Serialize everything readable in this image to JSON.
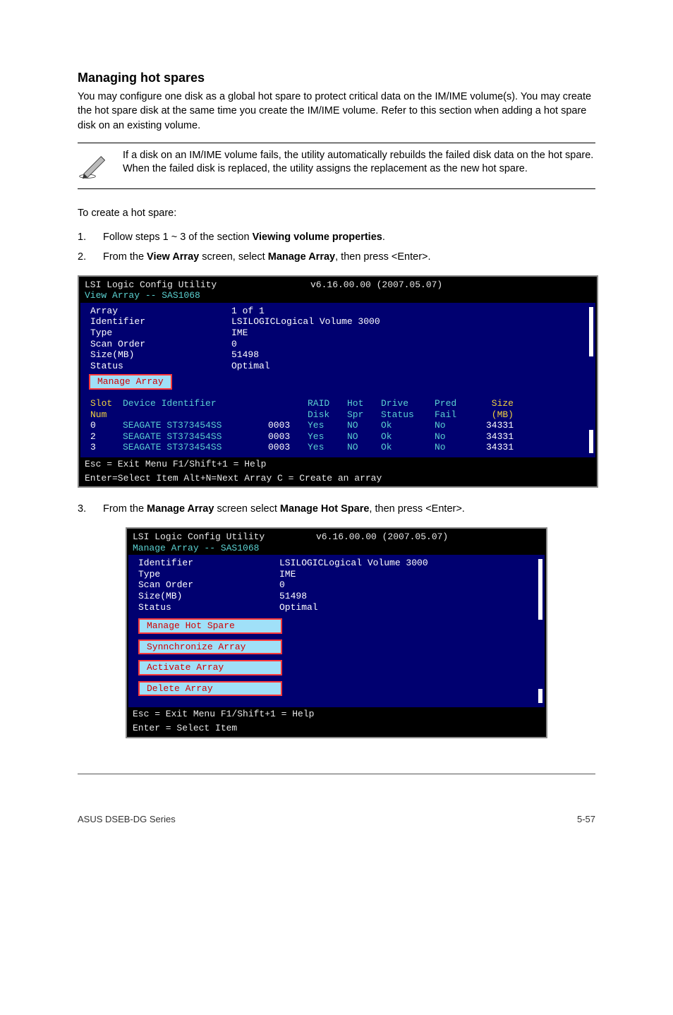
{
  "heading": "Managing hot spares",
  "intro": "You may configure one disk as a global hot spare to protect critical data on the IM/IME volume(s). You may create the hot spare disk at the same time you create the IM/IME volume. Refer to this section when adding a hot spare disk on an existing volume.",
  "note": "If a disk on an IM/IME volume fails, the utility automatically rebuilds the failed disk data on the hot spare. When the failed disk is replaced, the utility assigns the replacement as the new hot spare.",
  "lead": "To create a hot spare:",
  "steps": {
    "s1_num": "1.",
    "s1_a": "Follow steps 1 ~ 3 of the section ",
    "s1_b": "Viewing volume properties",
    "s1_c": ".",
    "s2_num": "2.",
    "s2_a": "From the ",
    "s2_b": "View Array",
    "s2_c": " screen, select ",
    "s2_d": "Manage Array",
    "s2_e": ", then press <Enter>.",
    "s3_num": "3.",
    "s3_a": "From the ",
    "s3_b": "Manage Array",
    "s3_c": " screen select ",
    "s3_d": "Manage Hot Spare",
    "s3_e": ", then press <Enter>."
  },
  "term1": {
    "title_left": "LSI Logic Config Utility",
    "title_right": "v6.16.00.00 (2007.05.07)",
    "sub": "View Array -- SAS1068",
    "fields": {
      "array_l": "Array",
      "array_v": "1 of 1",
      "id_l": "Identifier",
      "id_v": "LSILOGICLogical Volume  3000",
      "type_l": "Type",
      "type_v": "IME",
      "so_l": "Scan Order",
      "so_v": "0",
      "size_l": "Size(MB)",
      "size_v": "51498",
      "stat_l": "Status",
      "stat_v": "Optimal"
    },
    "manage": "Manage Array",
    "thead1": {
      "slot": "Slot",
      "dev": "Device Identifier",
      "num": "",
      "raid": "RAID",
      "hot": "Hot",
      "drive": "Drive",
      "pred": "Pred",
      "size": "Size"
    },
    "thead2": {
      "slot": "Num",
      "dev": "",
      "num": "",
      "raid": "Disk",
      "hot": "Spr",
      "drive": "Status",
      "pred": "Fail",
      "size": "(MB)"
    },
    "rows": [
      {
        "slot": "0",
        "dev": "SEAGATE ST373454SS",
        "num": "0003",
        "raid": "Yes",
        "hot": "NO",
        "drive": "Ok",
        "pred": "No",
        "size": "34331"
      },
      {
        "slot": "2",
        "dev": "SEAGATE ST373454SS",
        "num": "0003",
        "raid": "Yes",
        "hot": "NO",
        "drive": "Ok",
        "pred": "No",
        "size": "34331"
      },
      {
        "slot": "3",
        "dev": "SEAGATE ST373454SS",
        "num": "0003",
        "raid": "Yes",
        "hot": "NO",
        "drive": "Ok",
        "pred": "No",
        "size": "34331"
      }
    ],
    "foot1": "Esc = Exit Menu       F1/Shift+1 = Help",
    "foot2": "Enter=Select Item   Alt+N=Next Array   C = Create an array"
  },
  "term2": {
    "title_left": "LSI Logic Config Utility",
    "title_right": "v6.16.00.00 (2007.05.07)",
    "sub": "Manage Array -- SAS1068",
    "fields": {
      "id_l": "Identifier",
      "id_v": "LSILOGICLogical Volume  3000",
      "type_l": "Type",
      "type_v": "IME",
      "so_l": "Scan Order",
      "so_v": "0",
      "size_l": "Size(MB)",
      "size_v": "51498",
      "stat_l": "Status",
      "stat_v": "Optimal"
    },
    "items": {
      "i1": "Manage Hot Spare",
      "i2": "Synnchronize Array",
      "i3": "Activate Array",
      "i4": "Delete Array"
    },
    "foot1": "Esc = Exit Menu       F1/Shift+1 = Help",
    "foot2": "Enter = Select Item"
  },
  "footer_left": "ASUS DSEB-DG Series",
  "footer_right": "5-57"
}
